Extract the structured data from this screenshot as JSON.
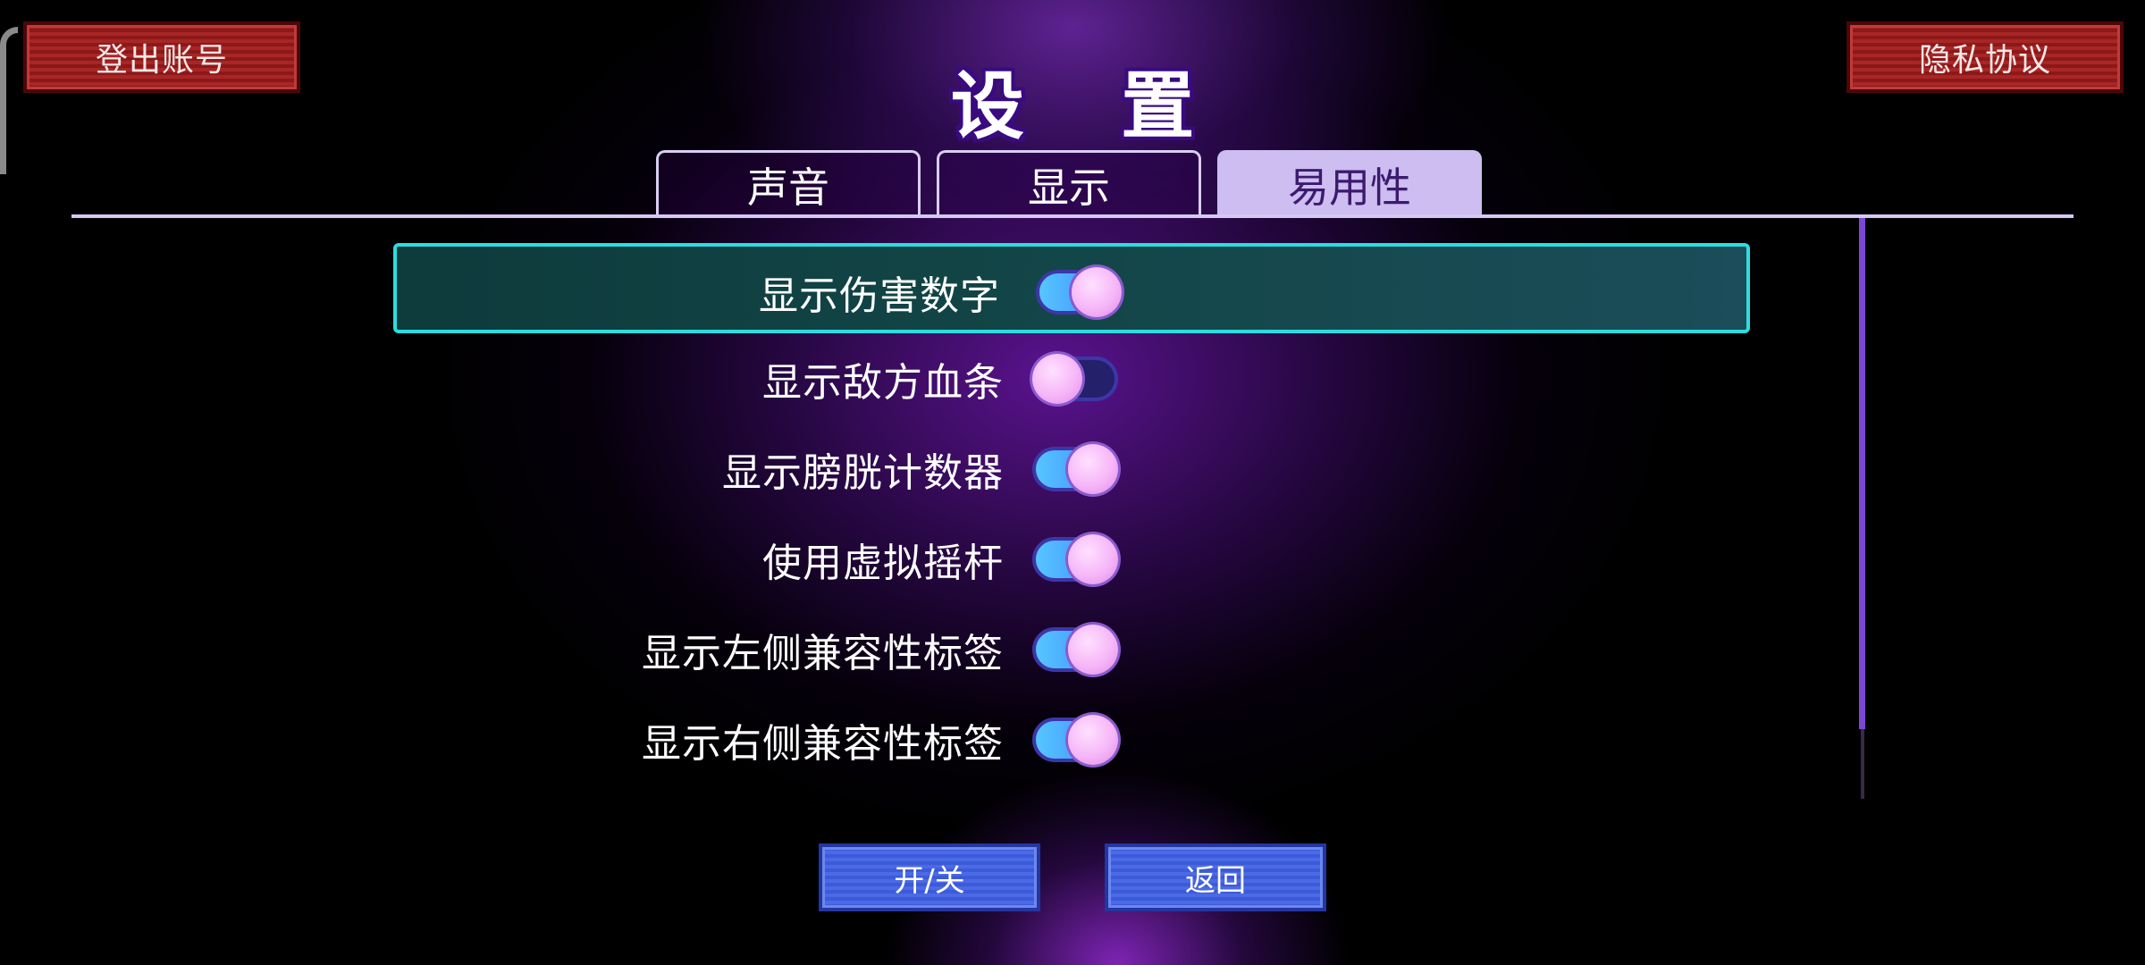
{
  "header": {
    "title": "设 置",
    "logout_label": "登出账号",
    "privacy_label": "隐私协议"
  },
  "tabs": [
    {
      "label": "声音",
      "active": false
    },
    {
      "label": "显示",
      "active": false
    },
    {
      "label": "易用性",
      "active": true
    }
  ],
  "settings": [
    {
      "label": "显示伤害数字",
      "enabled": true,
      "selected": true
    },
    {
      "label": "显示敌方血条",
      "enabled": false,
      "selected": false
    },
    {
      "label": "显示膀胱计数器",
      "enabled": true,
      "selected": false
    },
    {
      "label": "使用虚拟摇杆",
      "enabled": true,
      "selected": false
    },
    {
      "label": "显示左侧兼容性标签",
      "enabled": true,
      "selected": false
    },
    {
      "label": "显示右侧兼容性标签",
      "enabled": true,
      "selected": false
    }
  ],
  "footer": {
    "toggle_label": "开/关",
    "back_label": "返回"
  },
  "colors": {
    "accent_cyan": "#2bdde0",
    "tab_active": "#cdbdf0",
    "button_red": "#a82626",
    "button_blue": "#4a6ae6",
    "toggle_knob": "#f6b6f8"
  }
}
